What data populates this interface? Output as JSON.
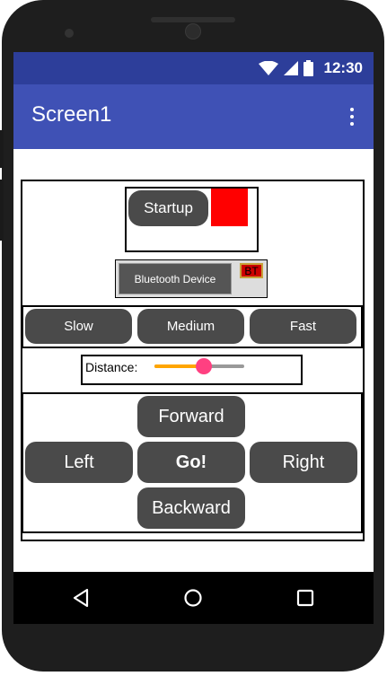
{
  "status_bar": {
    "time": "12:30",
    "wifi_icon": "wifi-icon",
    "signal_icon": "signal-icon",
    "battery_icon": "battery-icon"
  },
  "app_bar": {
    "title": "Screen1",
    "menu_icon": "overflow-menu-icon"
  },
  "startup": {
    "button_label": "Startup",
    "indicator_color": "#ff0000"
  },
  "bluetooth": {
    "button_label": "Bluetooth Device",
    "status_label": "BT",
    "status_color": "#cc0000"
  },
  "speed": {
    "slow_label": "Slow",
    "medium_label": "Medium",
    "fast_label": "Fast"
  },
  "distance": {
    "label": "Distance:",
    "slider_value": 0.55,
    "active_color": "#ffa500",
    "thumb_color": "#ff4081"
  },
  "controls": {
    "forward_label": "Forward",
    "left_label": "Left",
    "go_label": "Go!",
    "right_label": "Right",
    "backward_label": "Backward"
  },
  "navigation": {
    "back_icon": "back-triangle-icon",
    "home_icon": "home-circle-icon",
    "recents_icon": "recents-square-icon"
  }
}
